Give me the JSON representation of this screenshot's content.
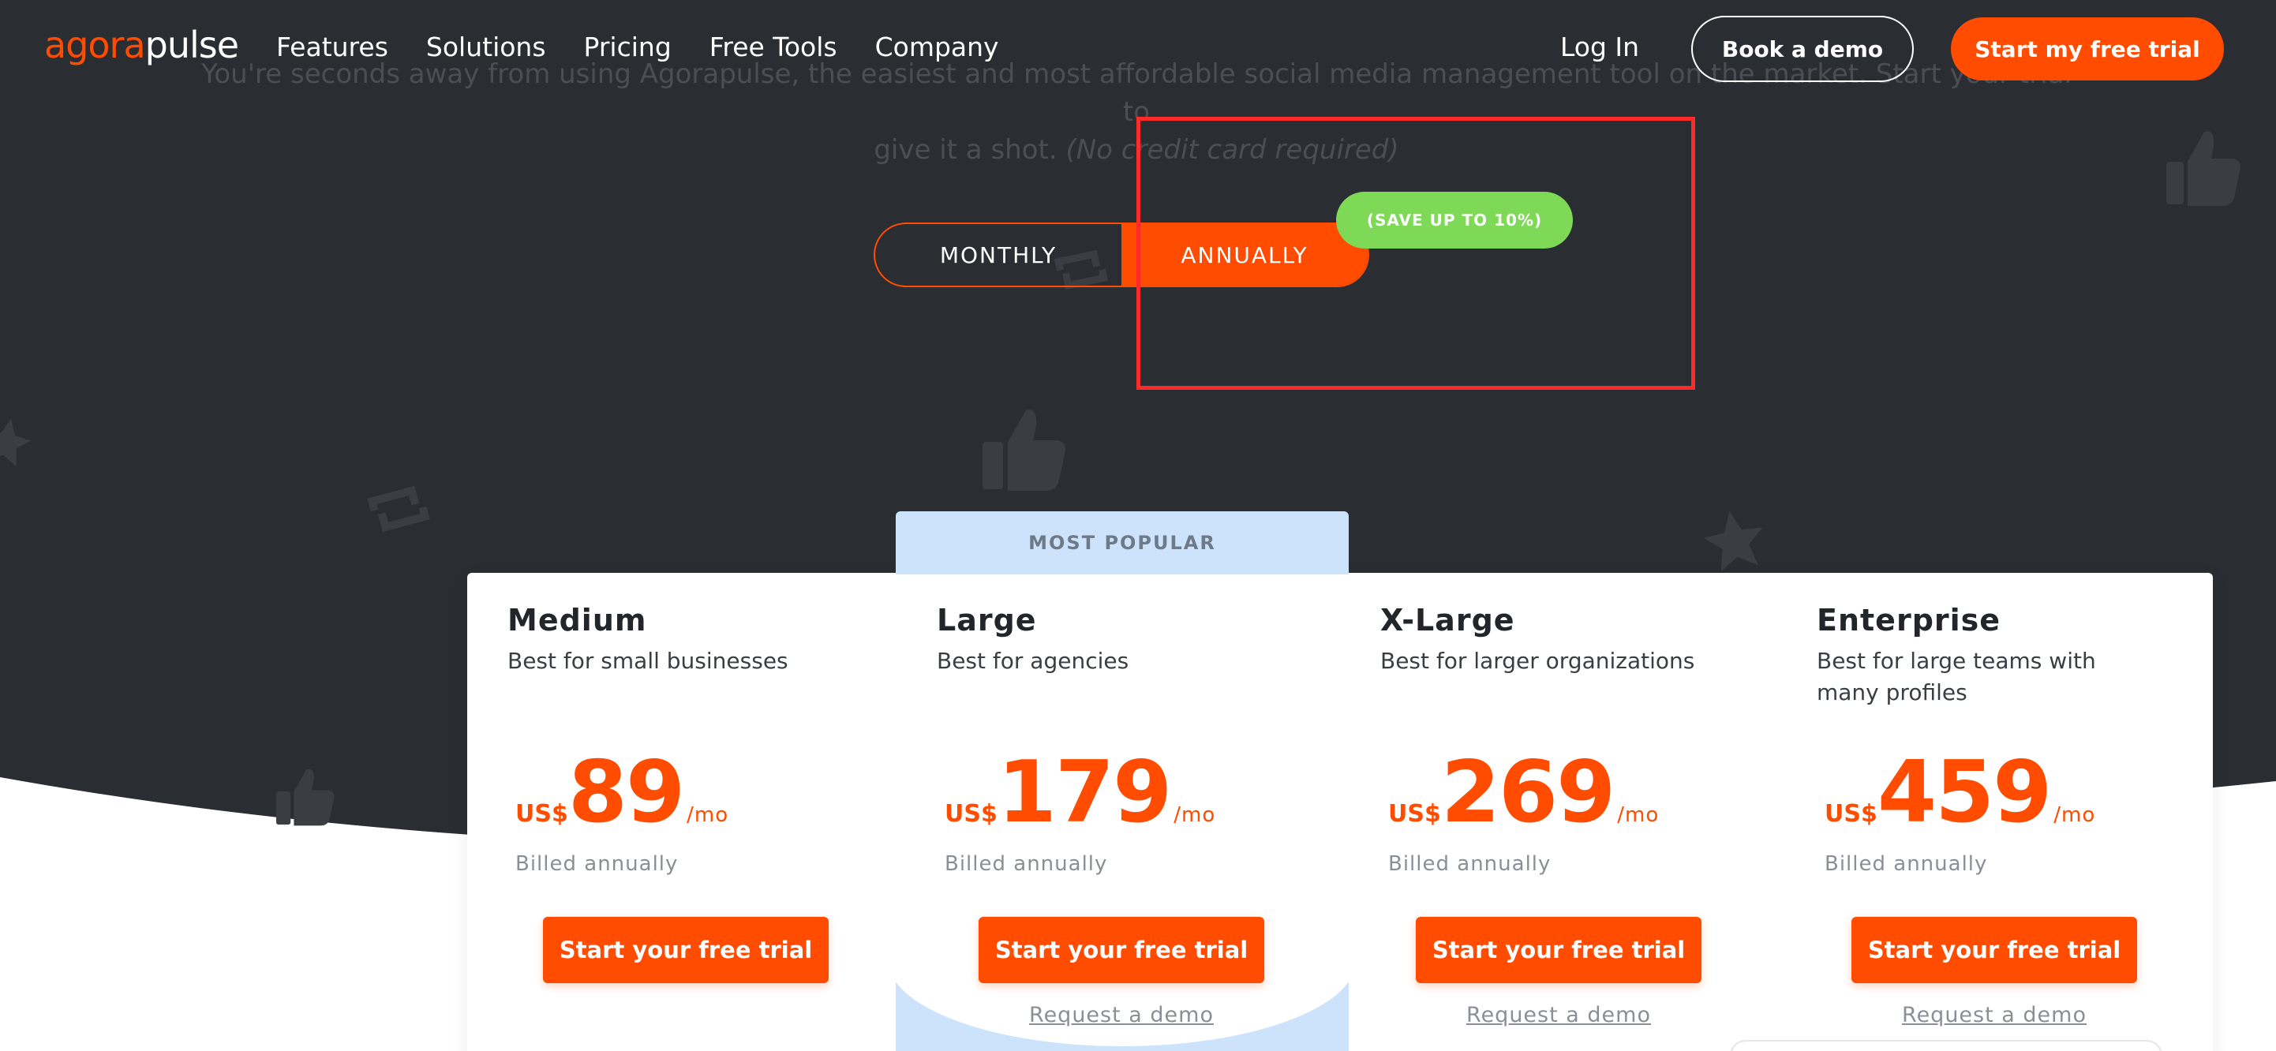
{
  "header": {
    "logo_agora": "agora",
    "logo_pulse": "pulse",
    "nav": [
      "Features",
      "Solutions",
      "Pricing",
      "Free Tools",
      "Company"
    ],
    "login": "Log In",
    "book_demo": "Book a demo",
    "start_trial": "Start my free trial"
  },
  "intro": {
    "line1": "You're seconds away from using Agorapulse, the easiest and most affordable social media management tool on the market. Start your trial to",
    "line2": "give it a shot.",
    "line2_italic": "(No credit card required)"
  },
  "billing": {
    "monthly": "MONTHLY",
    "annually": "ANNUALLY",
    "selected": "ANNUALLY",
    "save_badge": "(SAVE UP TO 10%)"
  },
  "most_popular": "MOST POPULAR",
  "plans": [
    {
      "name": "Medium",
      "desc": "Best for small businesses",
      "currency": "US$",
      "price": "89",
      "per": "/mo",
      "billed": "Billed annually",
      "cta": "Start your free trial",
      "demo": ""
    },
    {
      "name": "Large",
      "desc": "Best for agencies",
      "currency": "US$",
      "price": "179",
      "per": "/mo",
      "billed": "Billed annually",
      "cta": "Start your free trial",
      "demo": "Request a demo"
    },
    {
      "name": "X-Large",
      "desc": "Best for larger organizations",
      "currency": "US$",
      "price": "269",
      "per": "/mo",
      "billed": "Billed annually",
      "cta": "Start your free trial",
      "demo": "Request a demo"
    },
    {
      "name": "Enterprise",
      "desc": "Best for large teams with many profiles",
      "currency": "US$",
      "price": "459",
      "per": "/mo",
      "billed": "Billed annually",
      "cta": "Start your free trial",
      "demo": "Request a demo"
    }
  ],
  "colors": {
    "hero_bg": "#2a2e33",
    "accent": "#ff4c00",
    "save_green": "#7ed957",
    "popular_blue": "#cde3fb",
    "highlight_red": "#ff2a2a"
  },
  "icons": [
    "thumbs-up-icon",
    "star-icon",
    "retweet-icon"
  ]
}
